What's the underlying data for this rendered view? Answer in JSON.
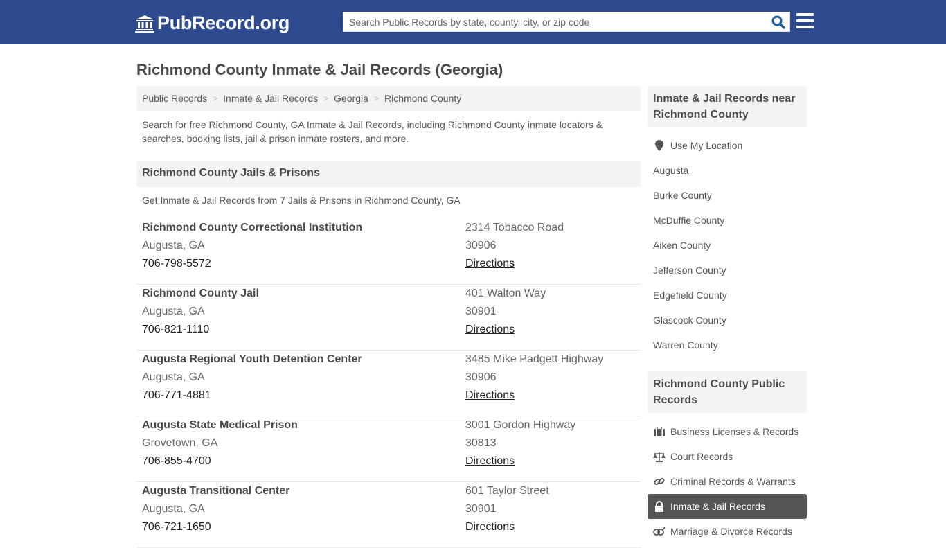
{
  "header": {
    "logo_text": "PubRecord.org",
    "search_placeholder": "Search Public Records by state, county, city, or zip code",
    "brand_color": "#2e4a8f"
  },
  "page": {
    "title": "Richmond County Inmate & Jail Records (Georgia)",
    "breadcrumb": [
      "Public Records",
      "Inmate & Jail Records",
      "Georgia",
      "Richmond County"
    ],
    "intro": "Search for free Richmond County, GA Inmate & Jail Records, including Richmond County inmate locators & searches, booking lists, jail & prison inmate rosters, and more."
  },
  "section": {
    "title": "Richmond County Jails & Prisons",
    "subtitle": "Get Inmate & Jail Records from 7 Jails & Prisons in Richmond County, GA",
    "facilities": [
      {
        "name": "Richmond County Correctional Institution",
        "city": "Augusta, GA",
        "phone": "706-798-5572",
        "address": "2314 Tobacco Road",
        "zip": "30906",
        "directions": "Directions"
      },
      {
        "name": "Richmond County Jail",
        "city": "Augusta, GA",
        "phone": "706-821-1110",
        "address": "401 Walton Way",
        "zip": "30901",
        "directions": "Directions"
      },
      {
        "name": "Augusta Regional Youth Detention Center",
        "city": "Augusta, GA",
        "phone": "706-771-4881",
        "address": "3485 Mike Padgett Highway",
        "zip": "30906",
        "directions": "Directions"
      },
      {
        "name": "Augusta State Medical Prison",
        "city": "Grovetown, GA",
        "phone": "706-855-4700",
        "address": "3001 Gordon Highway",
        "zip": "30813",
        "directions": "Directions"
      },
      {
        "name": "Augusta Transitional Center",
        "city": "Augusta, GA",
        "phone": "706-721-1650",
        "address": "601 Taylor Street",
        "zip": "30901",
        "directions": "Directions"
      }
    ]
  },
  "sidebar": {
    "nearby_title": "Inmate & Jail Records near Richmond County",
    "use_location": "Use My Location",
    "nearby": [
      "Augusta",
      "Burke County",
      "McDuffie County",
      "Aiken County",
      "Jefferson County",
      "Edgefield County",
      "Glascock County",
      "Warren County"
    ],
    "public_title": "Richmond County Public Records",
    "public_records": [
      {
        "label": "Business Licenses & Records",
        "icon": "briefcase-icon",
        "active": false
      },
      {
        "label": "Court Records",
        "icon": "scale-icon",
        "active": false
      },
      {
        "label": "Criminal Records & Warrants",
        "icon": "link-icon",
        "active": false
      },
      {
        "label": "Inmate & Jail Records",
        "icon": "lock-icon",
        "active": true
      },
      {
        "label": "Marriage & Divorce Records",
        "icon": "gender-icon",
        "active": false
      }
    ]
  }
}
